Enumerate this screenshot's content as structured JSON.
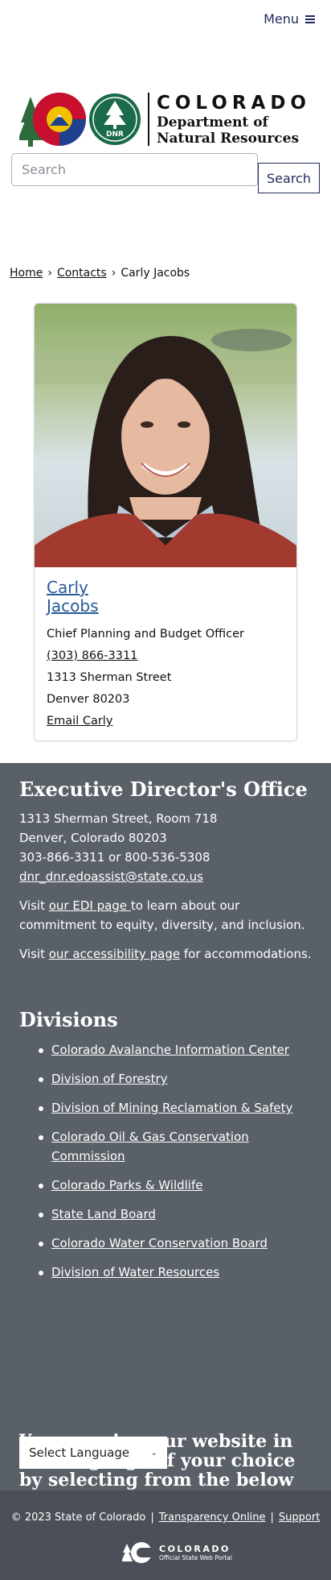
{
  "header": {
    "menu_label": "Menu",
    "logo_state": "COLORADO",
    "logo_dept_line1": "Department of",
    "logo_dept_line2": "Natural Resources",
    "logo_dnr_badge": "DNR",
    "search_placeholder": "Search",
    "search_button": "Search"
  },
  "breadcrumb": {
    "items": [
      "Home",
      "Contacts",
      "Carly Jacobs"
    ],
    "separator": "›"
  },
  "contact": {
    "name_first": "Carly",
    "name_last": "Jacobs",
    "title": "Chief Planning and Budget Officer",
    "phone": "(303) 866-3311",
    "street": "1313 Sherman Street",
    "city_zip": "Denver 80203",
    "email_label": "Email Carly"
  },
  "footer": {
    "office_heading": "Executive Director's Office",
    "address_line1": "1313 Sherman Street, Room 718",
    "address_line2": "Denver, Colorado 80203",
    "phone_line": "303-866-3311 or 800-536-5308",
    "email": "dnr_dnr.edoassist@state.co.us",
    "edi_prefix": "Visit ",
    "edi_link": "our EDI page ",
    "edi_suffix": "to learn about our commitment to equity, diversity, and inclusion.",
    "access_prefix": "Visit ",
    "access_link": "our accessibility page",
    "access_suffix": " for accommodations.",
    "divisions_heading": "Divisions",
    "divisions": [
      "Colorado Avalanche Information Center",
      "Division of Forestry",
      "Division of Mining Reclamation & Safety",
      "Colorado Oil & Gas Conservation Commission",
      "Colorado Parks & Wildlife",
      "State Land Board",
      "Colorado Water Conservation Board",
      "Division of Water Resources"
    ],
    "language_heading": "You can view our website in the language of your choice by selecting from the below options:",
    "language_select": "Select Language"
  },
  "bottom": {
    "copyright": "© 2023 State of Colorado",
    "transparency": "Transparency Online",
    "support": "Support",
    "portal_name": "COLORADO",
    "portal_sub": "Official State Web Portal"
  },
  "colors": {
    "navy": "#1f2a5c",
    "link_blue": "#2a5a98",
    "footer_bg": "#5a6068",
    "bottom_bg": "#4b5058"
  }
}
